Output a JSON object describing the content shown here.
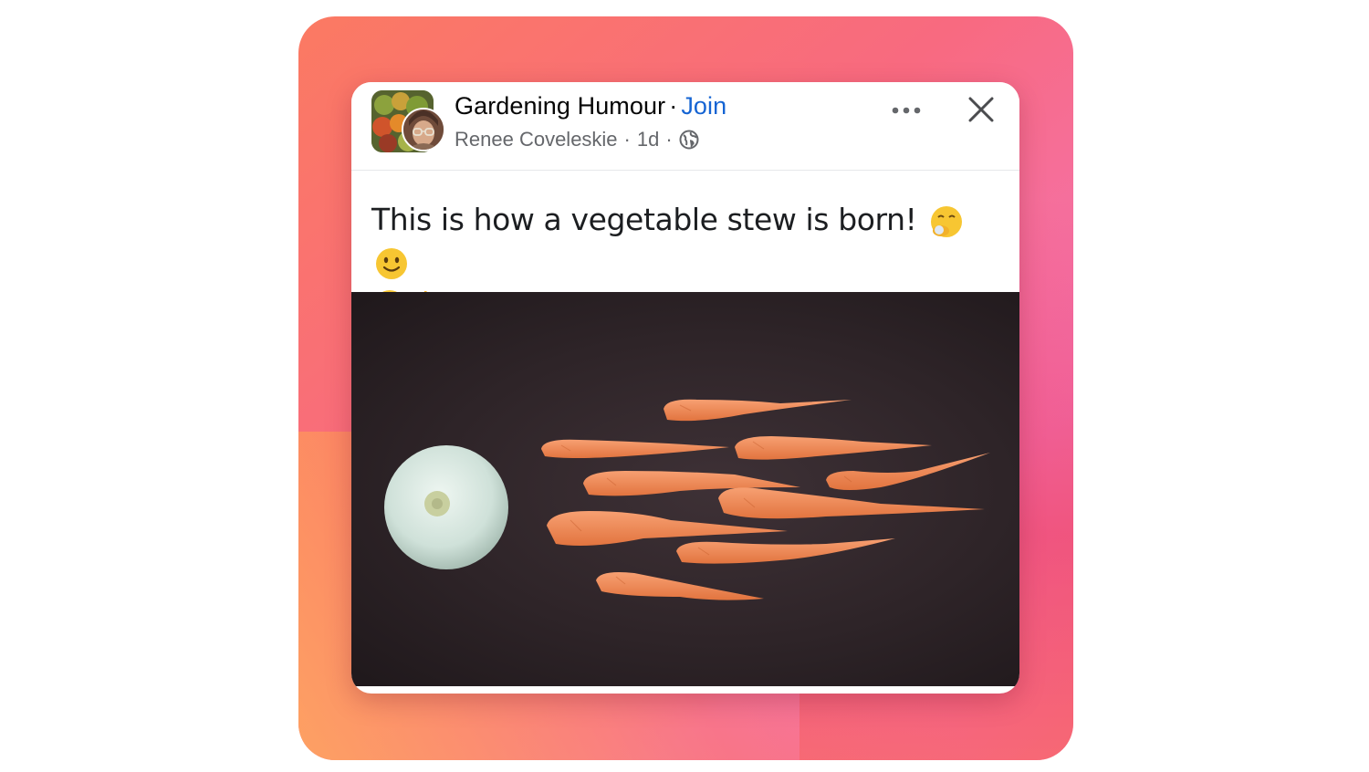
{
  "post": {
    "group_name": "Gardening Humour",
    "separator": "·",
    "join_label": "Join",
    "author": "Renee Coveleskie",
    "time": "1d",
    "privacy_icon": "globe-icon",
    "caption": "This is how a vegetable stew is born!",
    "caption_emojis": [
      "hand-over-mouth-emoji",
      "slightly-smiling-emoji",
      "grinning-emoji",
      "thumbs-up-emoji"
    ],
    "image_description_icon": "onion-and-carrots-photo"
  },
  "actions": {
    "more_icon": "more-dots-icon",
    "close_icon": "close-icon"
  },
  "colors": {
    "join": "#1564d3",
    "secondary_text": "#65676b",
    "background_gradient": [
      "#fb7a62",
      "#f373b3",
      "#ec3c5f",
      "#ffaa5a"
    ]
  }
}
